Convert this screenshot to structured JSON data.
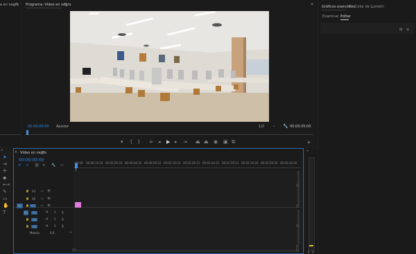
{
  "left_panel": {
    "title_fragment": "a en negro"
  },
  "program_monitor": {
    "tab_title": "Programa: Vídeo en negro",
    "timecode_current": "00:00:00:00",
    "zoom_select": "Ajustar",
    "resolution_select": "1/2",
    "timecode_duration": "00:00:05:00"
  },
  "essential_graphics": {
    "tab_title": "Gráficos esenciales",
    "tab_other": "Color de Lumetri",
    "subtab_browse": "Examinar",
    "subtab_edit": "Editar"
  },
  "timeline": {
    "tab_title": "Vídeo en negro",
    "timecode": "00:00:00:00",
    "ruler_labels": [
      "00:00",
      "00:00:14:23",
      "00:00:29:23",
      "00:00:44:22",
      "00:00:59:22",
      "00:01:14:22",
      "00:01:29:21",
      "00:01:44:21",
      "00:01:59:21",
      "00:02:14:20",
      "00:02:29:20",
      "00:02:44:20"
    ],
    "video_tracks": [
      {
        "name": "V3",
        "source": ""
      },
      {
        "name": "V2",
        "source": ""
      },
      {
        "name": "V1",
        "source": "V1"
      }
    ],
    "audio_tracks": [
      {
        "name": "A1",
        "source": "A1"
      },
      {
        "name": "A2",
        "source": ""
      },
      {
        "name": "A3",
        "source": ""
      }
    ],
    "mix_label": "Mezcla",
    "mix_value": "0,0"
  },
  "colors": {
    "accent": "#2d8ceb",
    "clip": "#e07be0",
    "playhead": "#4a90e2"
  }
}
